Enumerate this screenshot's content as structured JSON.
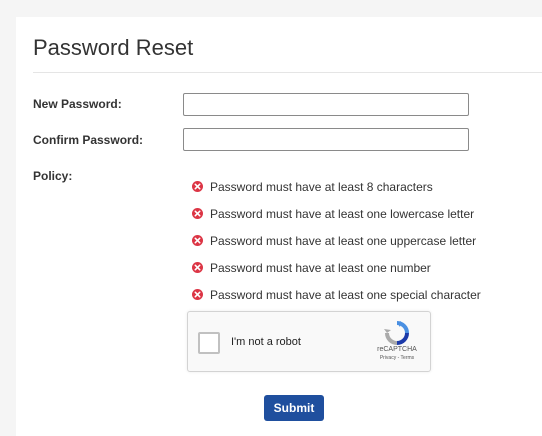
{
  "page": {
    "title": "Password Reset"
  },
  "form": {
    "new_password_label": "New Password:",
    "new_password_value": "",
    "confirm_password_label": "Confirm Password:",
    "confirm_password_value": "",
    "policy_label": "Policy:",
    "policy_items": [
      "Password must have at least 8 characters",
      "Password must have at least one lowercase letter",
      "Password must have at least one uppercase letter",
      "Password must have at least one number",
      "Password must have at least one special character"
    ],
    "policy_icon": "error-x-icon",
    "submit_label": "Submit"
  },
  "captcha": {
    "checkbox_label": "I'm not a robot",
    "brand": "reCAPTCHA",
    "links": "Privacy - Terms",
    "icon": "recaptcha-logo-icon"
  },
  "colors": {
    "error": "#dc3545",
    "primary": "#1f4f9e",
    "recaptcha_blue": "#4a90e2"
  }
}
